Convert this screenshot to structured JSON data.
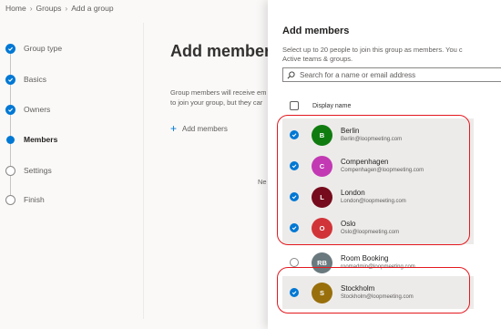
{
  "breadcrumb": [
    "Home",
    "Groups",
    "Add a group"
  ],
  "steps": [
    {
      "label": "Group type",
      "state": "done"
    },
    {
      "label": "Basics",
      "state": "done"
    },
    {
      "label": "Owners",
      "state": "done"
    },
    {
      "label": "Members",
      "state": "current"
    },
    {
      "label": "Settings",
      "state": "todo"
    },
    {
      "label": "Finish",
      "state": "todo"
    }
  ],
  "main": {
    "title": "Add members",
    "desc_line1": "Group members will receive em",
    "desc_line2": "to join your group, but they car",
    "add_link": "Add members",
    "hint": "Ne"
  },
  "panel": {
    "title": "Add members",
    "desc_line1": "Select up to 20 people to join this group as members. You c",
    "desc_line2": "Active teams & groups.",
    "search_placeholder": "Search for a name or email address",
    "column_header": "Display name"
  },
  "members": [
    {
      "initial": "B",
      "name": "Berlin",
      "email": "Berlin@loopmeeting.com",
      "color": "#107c10",
      "selected": true
    },
    {
      "initial": "C",
      "name": "Compenhagen",
      "email": "Compenhagen@loopmeeting.com",
      "color": "#c239b3",
      "selected": true
    },
    {
      "initial": "L",
      "name": "London",
      "email": "London@loopmeeting.com",
      "color": "#750b1c",
      "selected": true
    },
    {
      "initial": "O",
      "name": "Oslo",
      "email": "Oslo@loopmeeting.com",
      "color": "#d13438",
      "selected": true
    },
    {
      "initial": "RB",
      "name": "Room Booking",
      "email": "roomadmin@loopmeeting.com",
      "color": "#69797e",
      "selected": false
    },
    {
      "initial": "S",
      "name": "Stockholm",
      "email": "Stockholm@loopmeeting.com",
      "color": "#986f0b",
      "selected": true
    }
  ],
  "colors": {
    "accent": "#0078d4",
    "highlight": "#e3191f"
  }
}
